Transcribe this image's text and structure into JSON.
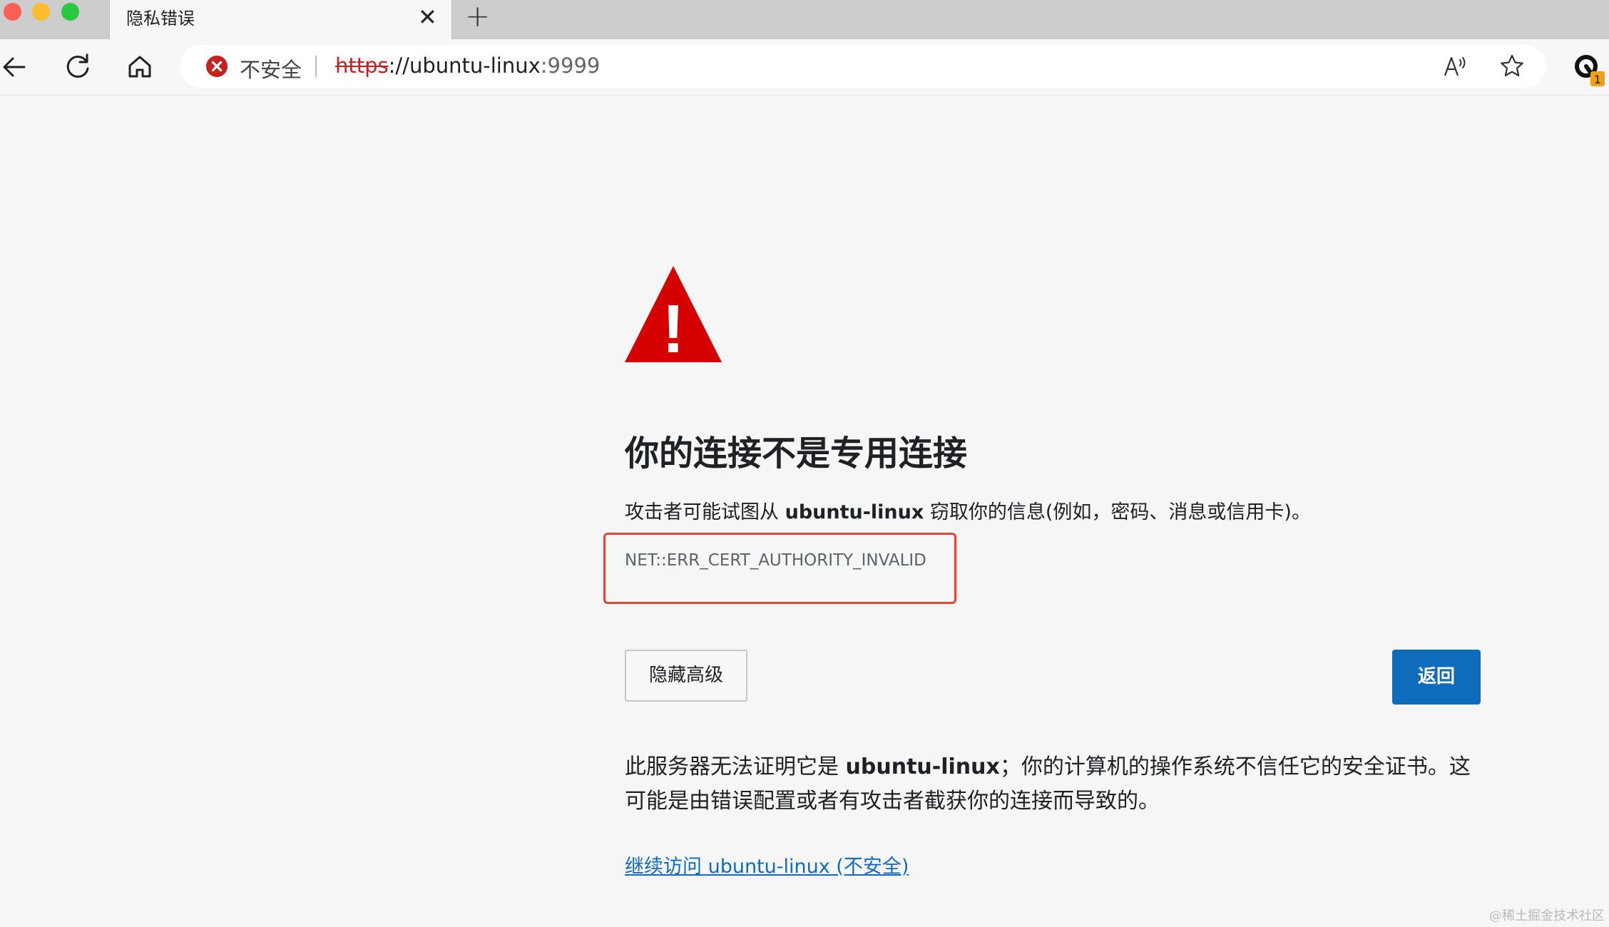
{
  "tab": {
    "title": "隐私错误",
    "close_symbol": "✕",
    "new_tab_symbol": "+"
  },
  "toolbar": {
    "icons": [
      "back-arrow-icon",
      "reload-icon",
      "home-icon",
      "read-aloud-icon",
      "favorite-star-icon",
      "extension-icon"
    ],
    "extension_badge": "1"
  },
  "address_bar": {
    "security_label": "不安全",
    "url_scheme": "https",
    "url_rest": "://ubuntu-linux",
    "url_port": ":9999",
    "read_aloud_glyph": "A"
  },
  "error_page": {
    "warning_icon_glyph": "!",
    "heading": "你的连接不是专用连接",
    "description_before": "攻击者可能试图从 ",
    "description_host": "ubuntu-linux",
    "description_after": " 窃取你的信息(例如，密码、消息或信用卡)。",
    "error_code": "NET::ERR_CERT_AUTHORITY_INVALID",
    "hide_advanced_button": "隐藏高级",
    "back_button": "返回",
    "explanation_before": "此服务器无法证明它是 ",
    "explanation_host": "ubuntu-linux",
    "explanation_after": "；你的计算机的操作系统不信任它的安全证书。这可能是由错误配置或者有攻击者截获你的连接而导致的。",
    "proceed_link": "继续访问 ubuntu-linux (不安全)"
  },
  "watermark": "@稀土掘金技术社区",
  "colors": {
    "accent_blue": "#0f6cbd",
    "warning_red": "#d50000",
    "highlight_box_red": "#e0483a",
    "insecure_red": "#c5221f"
  }
}
